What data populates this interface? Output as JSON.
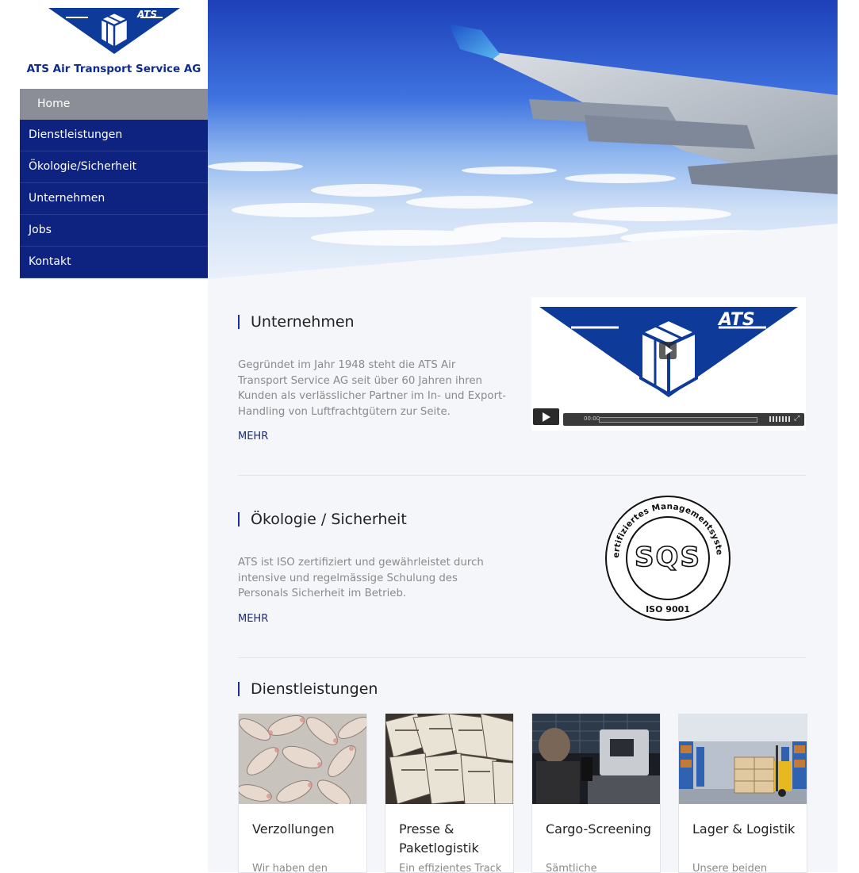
{
  "brand": {
    "badge": "ATS",
    "name": "ATS Air Transport Service AG"
  },
  "nav": {
    "items": [
      {
        "label": "Home",
        "active": true
      },
      {
        "label": "Dienstleistungen"
      },
      {
        "label": "Ökologie/Sicherheit"
      },
      {
        "label": "Unternehmen"
      },
      {
        "label": "Jobs"
      },
      {
        "label": "Kontakt"
      }
    ]
  },
  "sections": {
    "company": {
      "title": "Unternehmen",
      "text": "Gegründet im Jahr 1948 steht die ATS Air Transport Service AG seit über 60 Jahren ihren Kunden als verlässlicher Partner im In- und Export-Handling von Luftfrachtgütern zur Seite.",
      "more": "MEHR"
    },
    "video": {
      "badge": "ATS",
      "time": "00:00"
    },
    "ecology": {
      "title": "Ökologie / Sicherheit",
      "text": "ATS ist ISO zertifiziert und gewährleistet durch intensive und regelmässige Schulung des Personals Sicherheit im Betrieb.",
      "more": "MEHR"
    },
    "seal": {
      "ring_text": "Zertifiziertes Managementsystem",
      "center": "SQS",
      "bottom": "ISO 9001"
    },
    "services": {
      "title": "Dienstleistungen",
      "cards": [
        {
          "title": "Verzollungen",
          "desc": "Wir haben den"
        },
        {
          "title": "Presse & Paketlogistik",
          "desc": "Ein effizientes Track"
        },
        {
          "title": "Cargo-Screening",
          "desc": "Sämtliche"
        },
        {
          "title": "Lager & Logistik",
          "desc": "Unsere beiden"
        }
      ]
    }
  },
  "colors": {
    "navy": "#0e237f",
    "nav_active": "#8b8e96",
    "accent": "#1b2fa0",
    "brand_blue": "#0e3a9a"
  }
}
